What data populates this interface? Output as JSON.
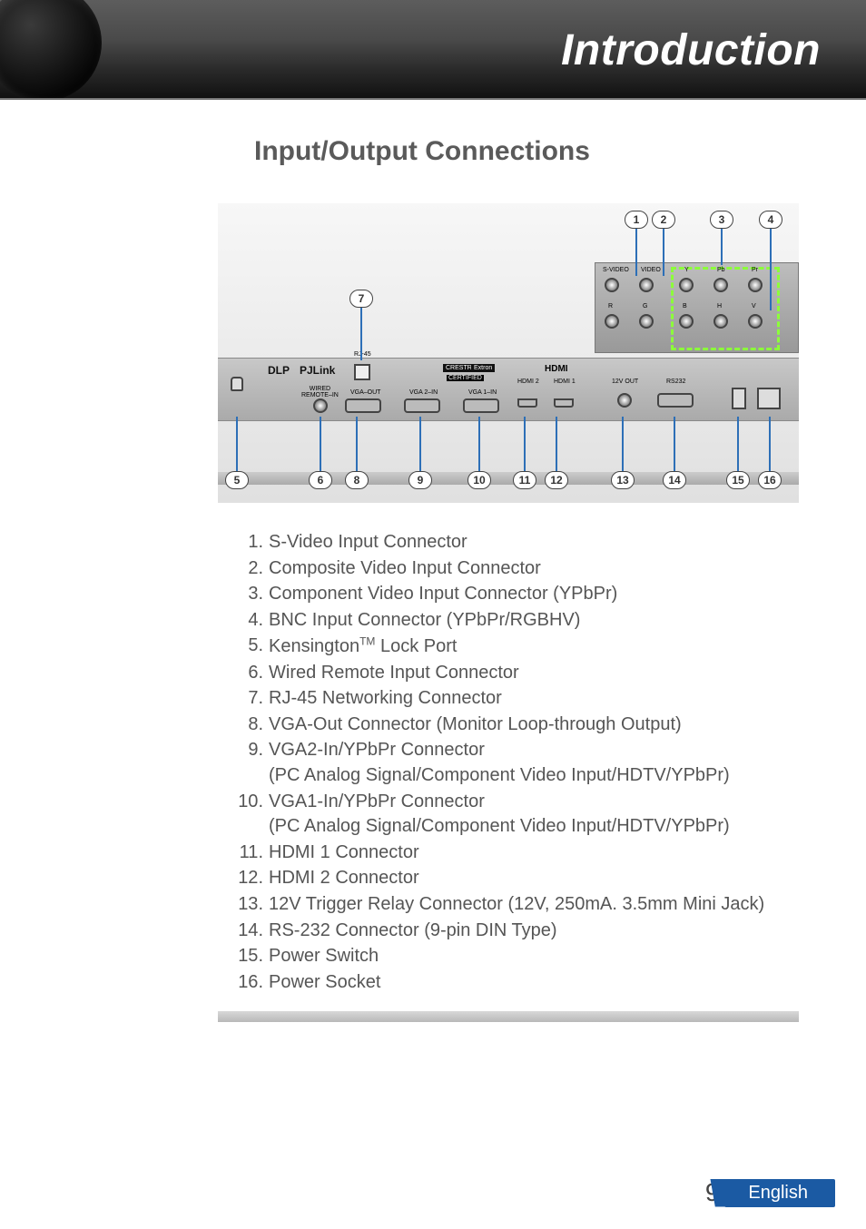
{
  "header": {
    "title": "Introduction"
  },
  "section": {
    "heading": "Input/Output Connections"
  },
  "diagram": {
    "callouts_top": [
      "1",
      "2",
      "3",
      "4"
    ],
    "callout_mid": "7",
    "callouts_bottom": [
      "5",
      "6",
      "8",
      "9",
      "10",
      "11",
      "12",
      "13",
      "14",
      "15",
      "16"
    ],
    "port_labels": {
      "svideo": "S-VIDEO",
      "video": "VIDEO",
      "y": "Y",
      "pb": "Pb",
      "pr": "Pr",
      "r": "R",
      "g": "G",
      "b": "B",
      "h": "H",
      "v": "V",
      "wired_remote": "WIRED\nREMOTE–IN",
      "vga_out": "VGA–OUT",
      "vga2_in": "VGA 2–IN",
      "vga1_in": "VGA 1–IN",
      "hdmi_logo": "HDMI",
      "hdmi2": "HDMI 2",
      "hdmi1": "HDMI 1",
      "out12v": "12V OUT",
      "rs232": "RS232",
      "rj45": "RJ-45",
      "pjlink": "PJLink",
      "extron": "Extron",
      "crestron": "CRESTRON",
      "certified": "CERTIFIED",
      "dlp": "DLP"
    }
  },
  "list": [
    "S-Video Input Connector",
    "Composite Video Input Connector",
    "Component Video Input Connector (YPbPr)",
    "BNC Input Connector (YPbPr/RGBHV)",
    "Kensington™ Lock Port",
    "Wired Remote Input Connector",
    "RJ-45 Networking Connector",
    "VGA-Out Connector (Monitor Loop-through Output)",
    "VGA2-In/YPbPr Connector\n(PC Analog Signal/Component Video Input/HDTV/YPbPr)",
    "VGA1-In/YPbPr Connector\n(PC Analog Signal/Component Video Input/HDTV/YPbPr)",
    "HDMI 1 Connector",
    "HDMI 2 Connector",
    "12V Trigger Relay Connector (12V, 250mA. 3.5mm Mini Jack)",
    "RS-232 Connector (9-pin DIN Type)",
    "Power Switch",
    "Power Socket"
  ],
  "footer": {
    "page": "9",
    "language": "English"
  }
}
